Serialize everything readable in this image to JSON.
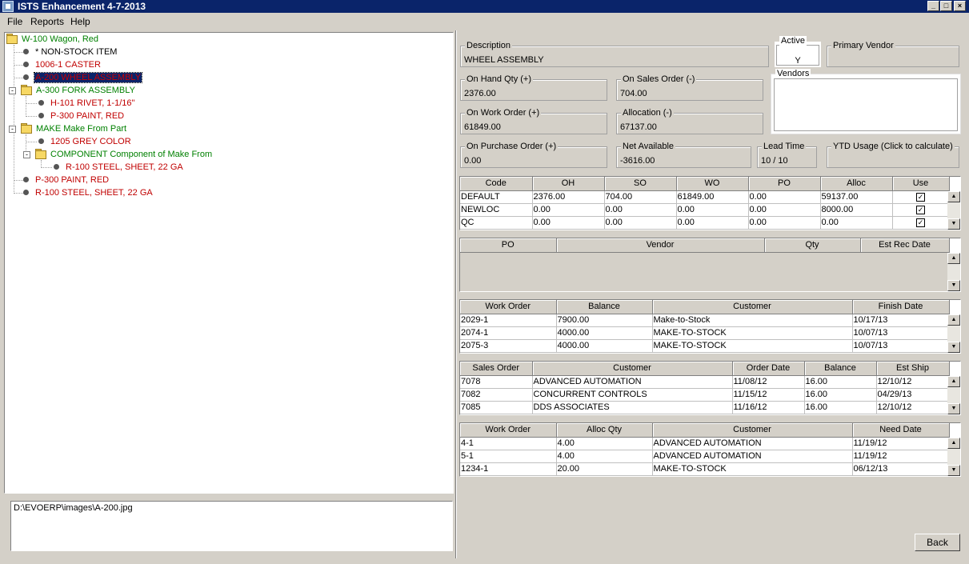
{
  "window": {
    "title": "ISTS Enhancement 4-7-2013",
    "minimize": "_",
    "maximize": "□",
    "close": "×"
  },
  "menu": [
    "File",
    "Reports",
    "Help"
  ],
  "tree": [
    {
      "label": "W-100 Wagon, Red",
      "kind": "folder",
      "color": "green"
    },
    {
      "label": "* NON-STOCK ITEM",
      "kind": "leaf",
      "color": "black"
    },
    {
      "label": "1006-1 CASTER",
      "kind": "leaf",
      "color": "red"
    },
    {
      "label": "A-200 WHEEL ASSEMBLY",
      "kind": "leaf",
      "color": "red",
      "selected": true
    },
    {
      "label": "A-300 FORK ASSEMBLY",
      "kind": "folder",
      "color": "green",
      "expander": "-"
    },
    {
      "label": "H-101 RIVET, 1-1/16\"",
      "kind": "leaf",
      "color": "red"
    },
    {
      "label": "P-300 PAINT, RED",
      "kind": "leaf",
      "color": "red"
    },
    {
      "label": "MAKE Make From Part",
      "kind": "folder",
      "color": "green",
      "expander": "-"
    },
    {
      "label": "1205 GREY COLOR",
      "kind": "leaf",
      "color": "red"
    },
    {
      "label": "COMPONENT Component of Make From",
      "kind": "folder",
      "color": "green",
      "expander": "-"
    },
    {
      "label": "R-100 STEEL, SHEET, 22 GA",
      "kind": "leaf",
      "color": "red"
    },
    {
      "label": "P-300 PAINT, RED",
      "kind": "leaf",
      "color": "red"
    },
    {
      "label": "R-100 STEEL, SHEET, 22 GA",
      "kind": "leaf",
      "color": "red"
    }
  ],
  "image_path": "D:\\EVOERP\\images\\A-200.jpg",
  "fields": {
    "description": {
      "label": "Description",
      "value": "WHEEL ASSEMBLY"
    },
    "active": {
      "label": "Active",
      "value": "Y"
    },
    "primary_vendor": {
      "label": "Primary Vendor",
      "value": ""
    },
    "vendors": {
      "label": "Vendors"
    },
    "on_hand": {
      "label": "On Hand Qty (+)",
      "value": "2376.00"
    },
    "on_sales_order": {
      "label": "On Sales Order (-)",
      "value": "704.00"
    },
    "on_work_order": {
      "label": "On Work Order (+)",
      "value": "61849.00"
    },
    "allocation": {
      "label": "Allocation (-)",
      "value": "67137.00"
    },
    "on_purchase_order": {
      "label": "On Purchase Order (+)",
      "value": "0.00"
    },
    "net_available": {
      "label": "Net Available",
      "value": "-3616.00"
    },
    "lead_time": {
      "label": "Lead Time",
      "value": "10 / 10"
    },
    "ytd_usage": {
      "label": "YTD Usage (Click to calculate)",
      "value": ""
    }
  },
  "locations_grid": {
    "columns": [
      "Code",
      "OH",
      "SO",
      "WO",
      "PO",
      "Alloc",
      "Use"
    ],
    "rows": [
      [
        "DEFAULT",
        "2376.00",
        "704.00",
        "61849.00",
        "0.00",
        "59137.00"
      ],
      [
        "NEWLOC",
        "0.00",
        "0.00",
        "0.00",
        "0.00",
        "8000.00"
      ],
      [
        "QC",
        "0.00",
        "0.00",
        "0.00",
        "0.00",
        "0.00"
      ]
    ],
    "use_checked": [
      true,
      true,
      true
    ],
    "check_glyph": "✓"
  },
  "po_grid": {
    "columns": [
      "PO",
      "Vendor",
      "Qty",
      "Est Rec Date"
    ],
    "rows": []
  },
  "work_order_grid": {
    "columns": [
      "Work Order",
      "Balance",
      "Customer",
      "Finish Date"
    ],
    "rows": [
      [
        "2029-1",
        "7900.00",
        "Make-to-Stock",
        "10/17/13"
      ],
      [
        "2074-1",
        "4000.00",
        "MAKE-TO-STOCK",
        "10/07/13"
      ],
      [
        "2075-3",
        "4000.00",
        "MAKE-TO-STOCK",
        "10/07/13"
      ]
    ]
  },
  "sales_order_grid": {
    "columns": [
      "Sales Order",
      "Customer",
      "Order Date",
      "Balance",
      "Est Ship"
    ],
    "rows": [
      [
        "7078",
        "ADVANCED AUTOMATION",
        "11/08/12",
        "16.00",
        "12/10/12"
      ],
      [
        "7082",
        "CONCURRENT CONTROLS",
        "11/15/12",
        "16.00",
        "04/29/13"
      ],
      [
        "7085",
        "DDS ASSOCIATES",
        "11/16/12",
        "16.00",
        "12/10/12"
      ]
    ]
  },
  "allocation_grid": {
    "columns": [
      "Work Order",
      "Alloc Qty",
      "Customer",
      "Need Date"
    ],
    "rows": [
      [
        "4-1",
        "4.00",
        "ADVANCED AUTOMATION",
        "11/19/12"
      ],
      [
        "5-1",
        "4.00",
        "ADVANCED AUTOMATION",
        "11/19/12"
      ],
      [
        "1234-1",
        "20.00",
        "MAKE-TO-STOCK",
        "06/12/13"
      ]
    ]
  },
  "scroll_glyphs": {
    "up": "▲",
    "down": "▼"
  },
  "back_label": "Back"
}
